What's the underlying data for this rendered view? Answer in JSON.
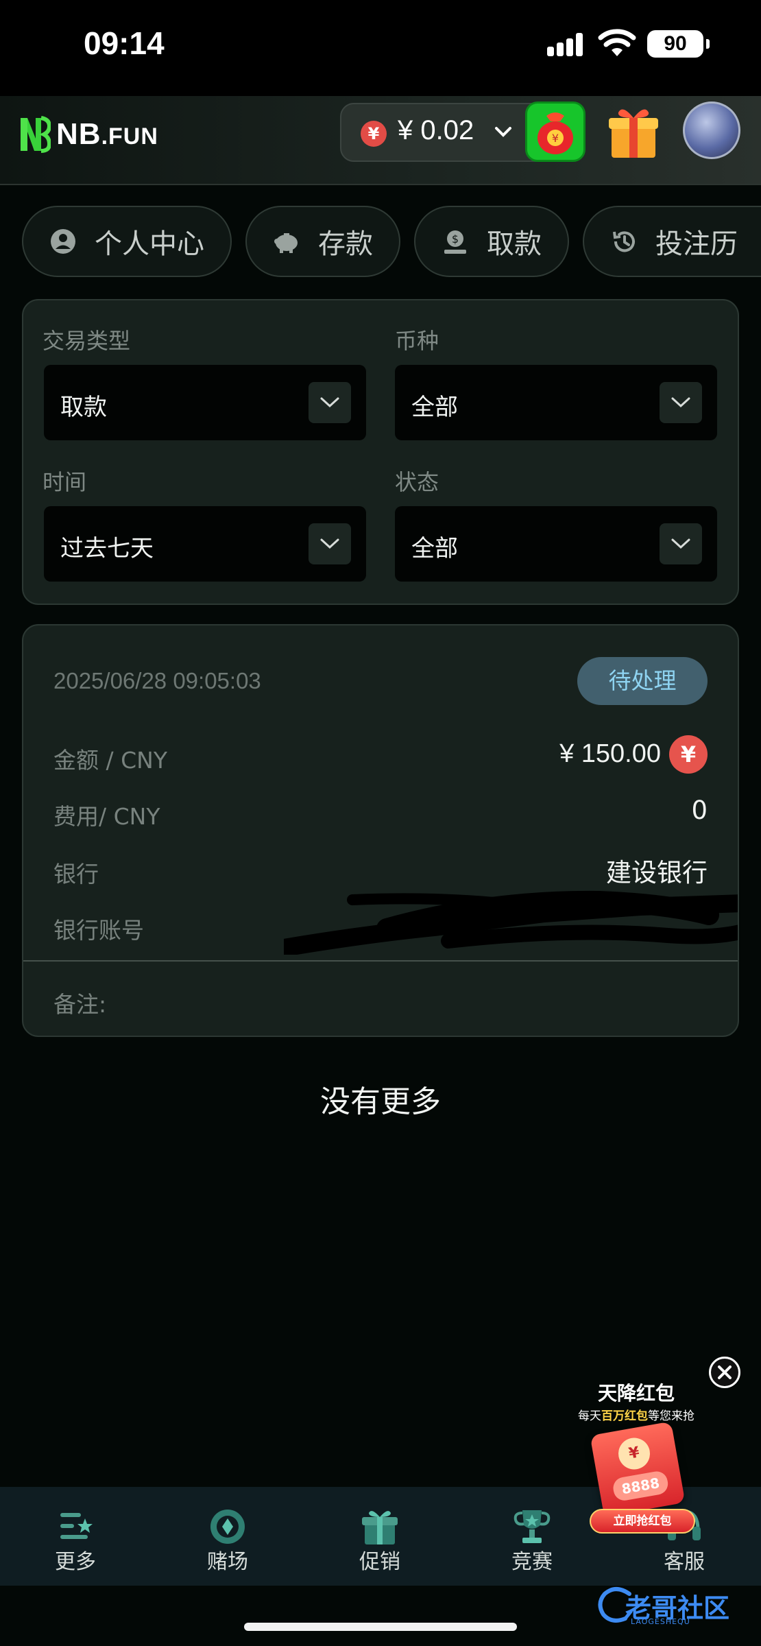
{
  "status_bar": {
    "time": "09:14",
    "battery": "90"
  },
  "header": {
    "logo_text": "NB",
    "logo_suffix": ".FUN",
    "balance": "¥ 0.02",
    "currency_symbol": "¥"
  },
  "tabs": [
    {
      "label": "个人中心",
      "icon": "user-circle-icon"
    },
    {
      "label": "存款",
      "icon": "piggy-bank-icon"
    },
    {
      "label": "取款",
      "icon": "money-withdraw-icon"
    },
    {
      "label": "投注历",
      "icon": "history-icon"
    }
  ],
  "filters": {
    "type_label": "交易类型",
    "type_value": "取款",
    "currency_label": "币种",
    "currency_value": "全部",
    "time_label": "时间",
    "time_value": "过去七天",
    "status_label": "状态",
    "status_value": "全部"
  },
  "record": {
    "timestamp": "2025/06/28 09:05:03",
    "status": "待处理",
    "amount_label": "金额 / CNY",
    "amount_value": "¥ 150.00",
    "amount_icon": "¥",
    "fee_label": "费用/ CNY",
    "fee_value": "0",
    "bank_label": "银行",
    "bank_value": "建设银行",
    "account_label": "银行账号",
    "note_label": "备注:"
  },
  "list_end": "没有更多",
  "bottom_nav": [
    {
      "label": "更多",
      "icon": "menu-star-icon"
    },
    {
      "label": "赌场",
      "icon": "casino-chip-icon"
    },
    {
      "label": "促销",
      "icon": "gift-icon"
    },
    {
      "label": "竞赛",
      "icon": "trophy-icon"
    },
    {
      "label": "客服",
      "icon": "headset-icon"
    }
  ],
  "promo": {
    "title": "天降红包",
    "subtitle_pre": "每天",
    "subtitle_highlight": "百万红包",
    "subtitle_post": "等您来抢",
    "envelope_amount": "8888",
    "envelope_seal": "¥",
    "button": "立即抢红包"
  },
  "watermark": {
    "text": "老哥社区",
    "sub": "LAOGESHEQU"
  },
  "colors": {
    "accent_green": "#17c52b",
    "pending_badge": "#42606e",
    "pending_text": "#8fd4f2",
    "coin_red": "#e6544d"
  }
}
